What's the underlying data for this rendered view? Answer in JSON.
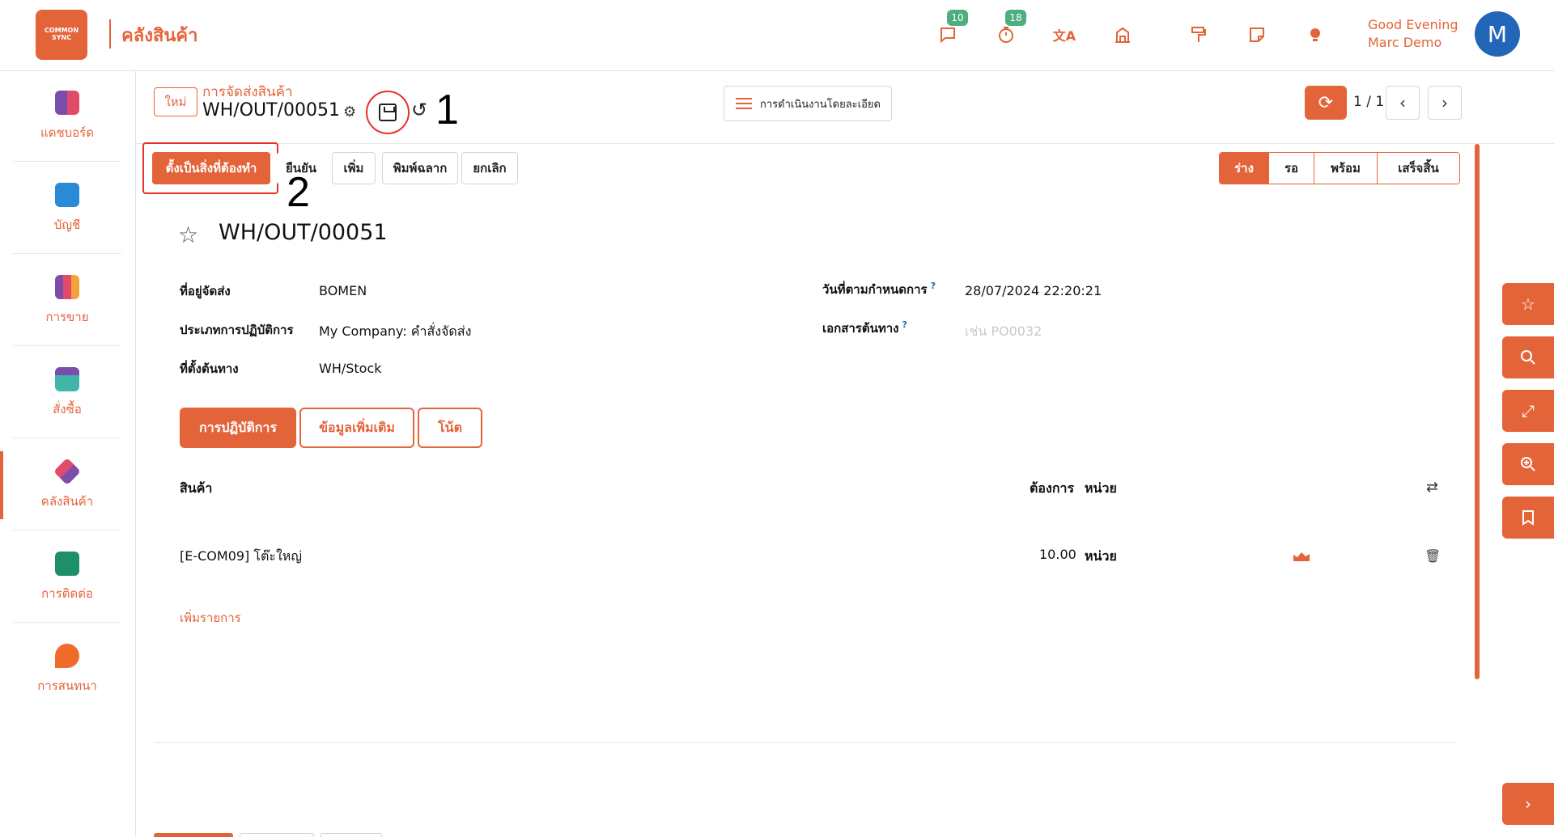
{
  "header": {
    "logo_text": "COMMON SYNC",
    "app_title": "คลังสินค้า",
    "icons": [
      {
        "name": "chat-icon",
        "glyph": "💬",
        "badge": "10"
      },
      {
        "name": "timer-icon",
        "glyph": "⏱",
        "badge": "18"
      },
      {
        "name": "translate-icon",
        "glyph": "文A"
      },
      {
        "name": "company-icon",
        "glyph": "🏛"
      },
      {
        "name": "paint-roller-icon",
        "glyph": "🖌"
      },
      {
        "name": "note-icon",
        "glyph": "🗒"
      },
      {
        "name": "lightbulb-icon",
        "glyph": "💡"
      }
    ],
    "greeting_line1": "Good Evening",
    "greeting_line2": "Marc Demo",
    "avatar_letter": "M",
    "accent_color": "#e4643a"
  },
  "sidebar": {
    "items": [
      {
        "label": "แดชบอร์ด",
        "icon": "dashboard-icon"
      },
      {
        "label": "บัญชี",
        "icon": "accounting-icon"
      },
      {
        "label": "การขาย",
        "icon": "sales-icon"
      },
      {
        "label": "สั่งซื้อ",
        "icon": "purchase-icon"
      },
      {
        "label": "คลังสินค้า",
        "icon": "inventory-icon"
      },
      {
        "label": "การติดต่อ",
        "icon": "contacts-icon"
      },
      {
        "label": "การสนทนา",
        "icon": "discuss-icon"
      }
    ],
    "active_index": 4
  },
  "control_panel": {
    "new_label": "ใหม่",
    "breadcrumb_parent": "การจัดส่งสินค้า",
    "breadcrumb_current": "WH/OUT/00051",
    "annotation_1": "1",
    "actions_label": "การดำเนินงานโดยละเอียด",
    "pager": "1 / 1"
  },
  "status_bar": {
    "buttons": [
      "ตั้งเป็นสิ่งที่ต้องทำ",
      "ยืนยัน",
      "เพิ่ม",
      "พิมพ์ฉลาก",
      "ยกเลิก"
    ],
    "annotation_2": "2",
    "stages": [
      "ร่าง",
      "รอ",
      "พร้อม",
      "เสร็จสิ้น"
    ],
    "current_stage": "ร่าง"
  },
  "record": {
    "title": "WH/OUT/00051",
    "delivery_address_label": "ที่อยู่จัดส่ง",
    "delivery_address": "BOMEN",
    "operation_type_label": "ประเภทการปฏิบัติการ",
    "operation_type": "My Company: คำสั่งจัดส่ง",
    "source_location_label": "ที่ตั้งต้นทาง",
    "source_location": "WH/Stock",
    "scheduled_date_label": "วันที่ตามกำหนดการ",
    "scheduled_date": "28/07/2024 22:20:21",
    "source_document_label": "เอกสารต้นทาง",
    "source_document_placeholder": "เช่น PO0032",
    "help_mark": "?"
  },
  "tabs": [
    "การปฏิบัติการ",
    "ข้อมูลเพิ่มเติม",
    "โน้ต"
  ],
  "moves_table": {
    "headers": {
      "product": "สินค้า",
      "demand": "ต้องการ",
      "unit": "หน่วย"
    },
    "rows": [
      {
        "product": "[E-COM09] โต๊ะใหญ่",
        "demand": "10.00",
        "unit": "หน่วย"
      }
    ],
    "add_line": "เพิ่มรายการ"
  },
  "floating_buttons": [
    "star-icon",
    "search-icon",
    "expand-icon",
    "zoom-in-icon",
    "bookmark-icon"
  ]
}
